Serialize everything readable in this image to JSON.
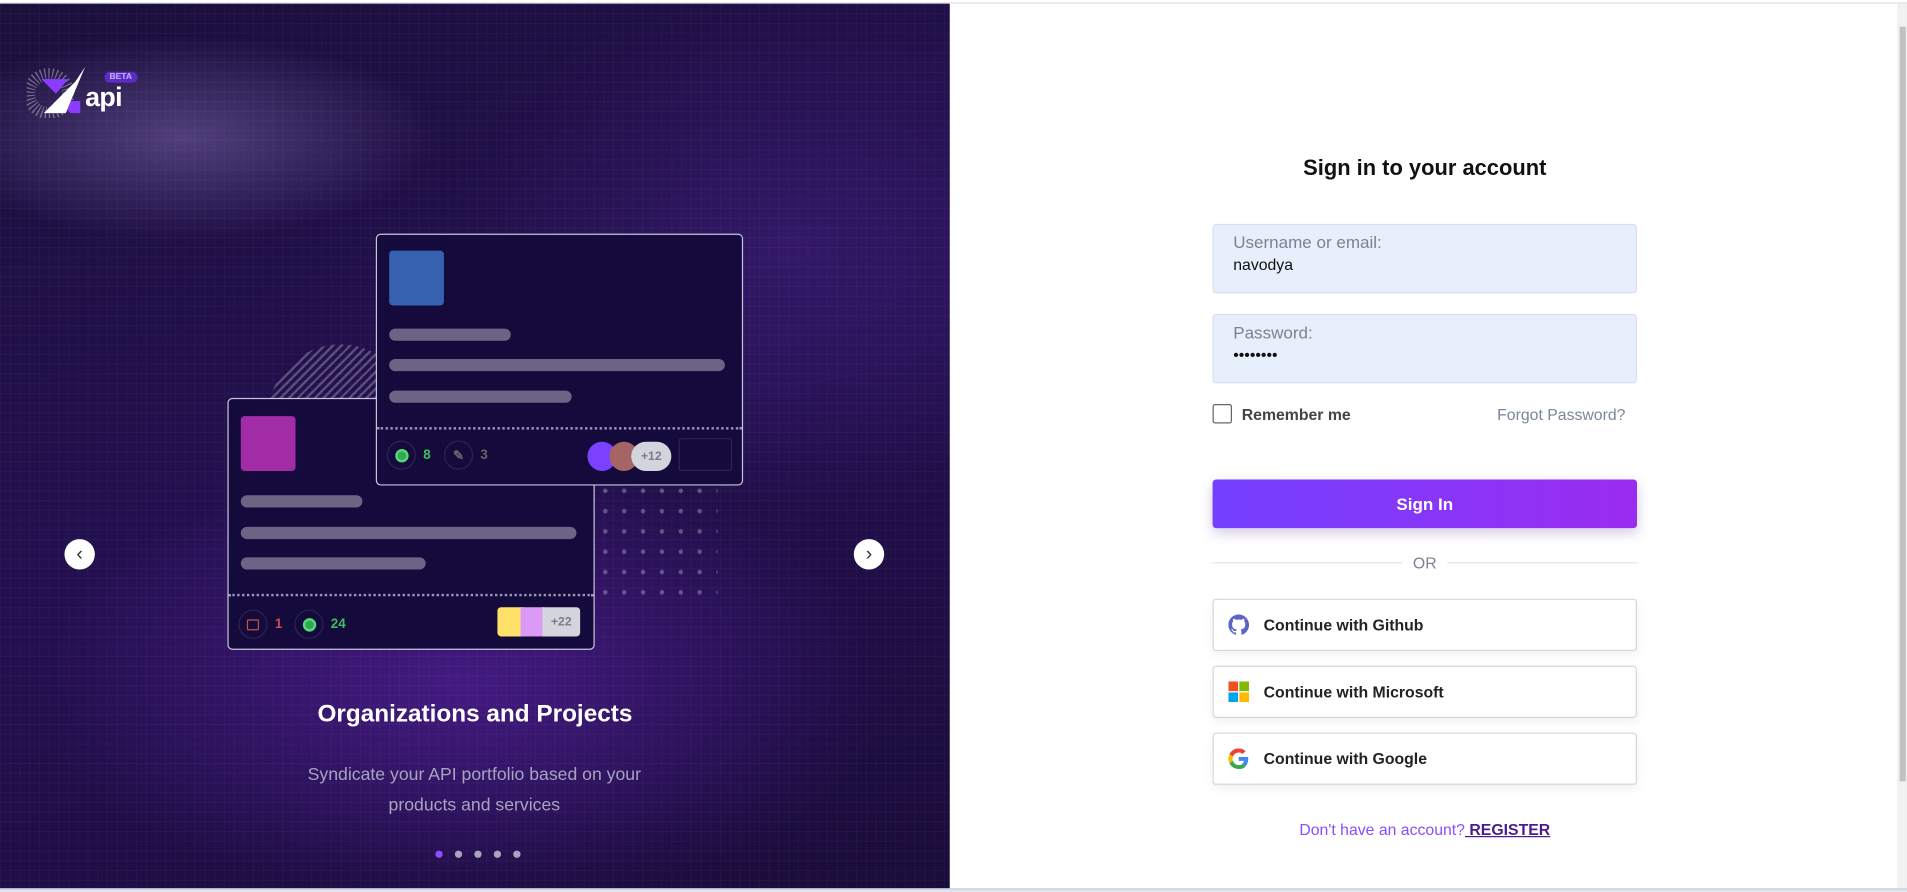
{
  "brand": {
    "logo_text": "api",
    "badge": "BETA"
  },
  "carousel": {
    "title": "Organizations and Projects",
    "subtitle": "Syndicate your API portfolio based on your products and services",
    "slide_count": 5,
    "active_slide": 1,
    "card_front": {
      "stat1": "1",
      "stat2": "24",
      "more": "+22"
    },
    "card_back": {
      "stat1": "8",
      "stat2": "3",
      "more": "+12"
    }
  },
  "form": {
    "title": "Sign in to your account",
    "username_label": "Username or email:",
    "username_value": "navodya",
    "password_label": "Password:",
    "password_value": "••••••••",
    "remember_label": "Remember me",
    "remember_checked": false,
    "forgot_label": "Forgot Password?",
    "signin_label": "Sign In",
    "or_label": "OR",
    "github_label": "Continue with Github",
    "microsoft_label": "Continue with Microsoft",
    "google_label": "Continue with Google",
    "register_prompt": "Don't have an account?",
    "register_label": " REGISTER"
  },
  "colors": {
    "accent": "#7c3aed",
    "panel_bg": "#1b0f3c",
    "input_bg": "#e8effc"
  }
}
